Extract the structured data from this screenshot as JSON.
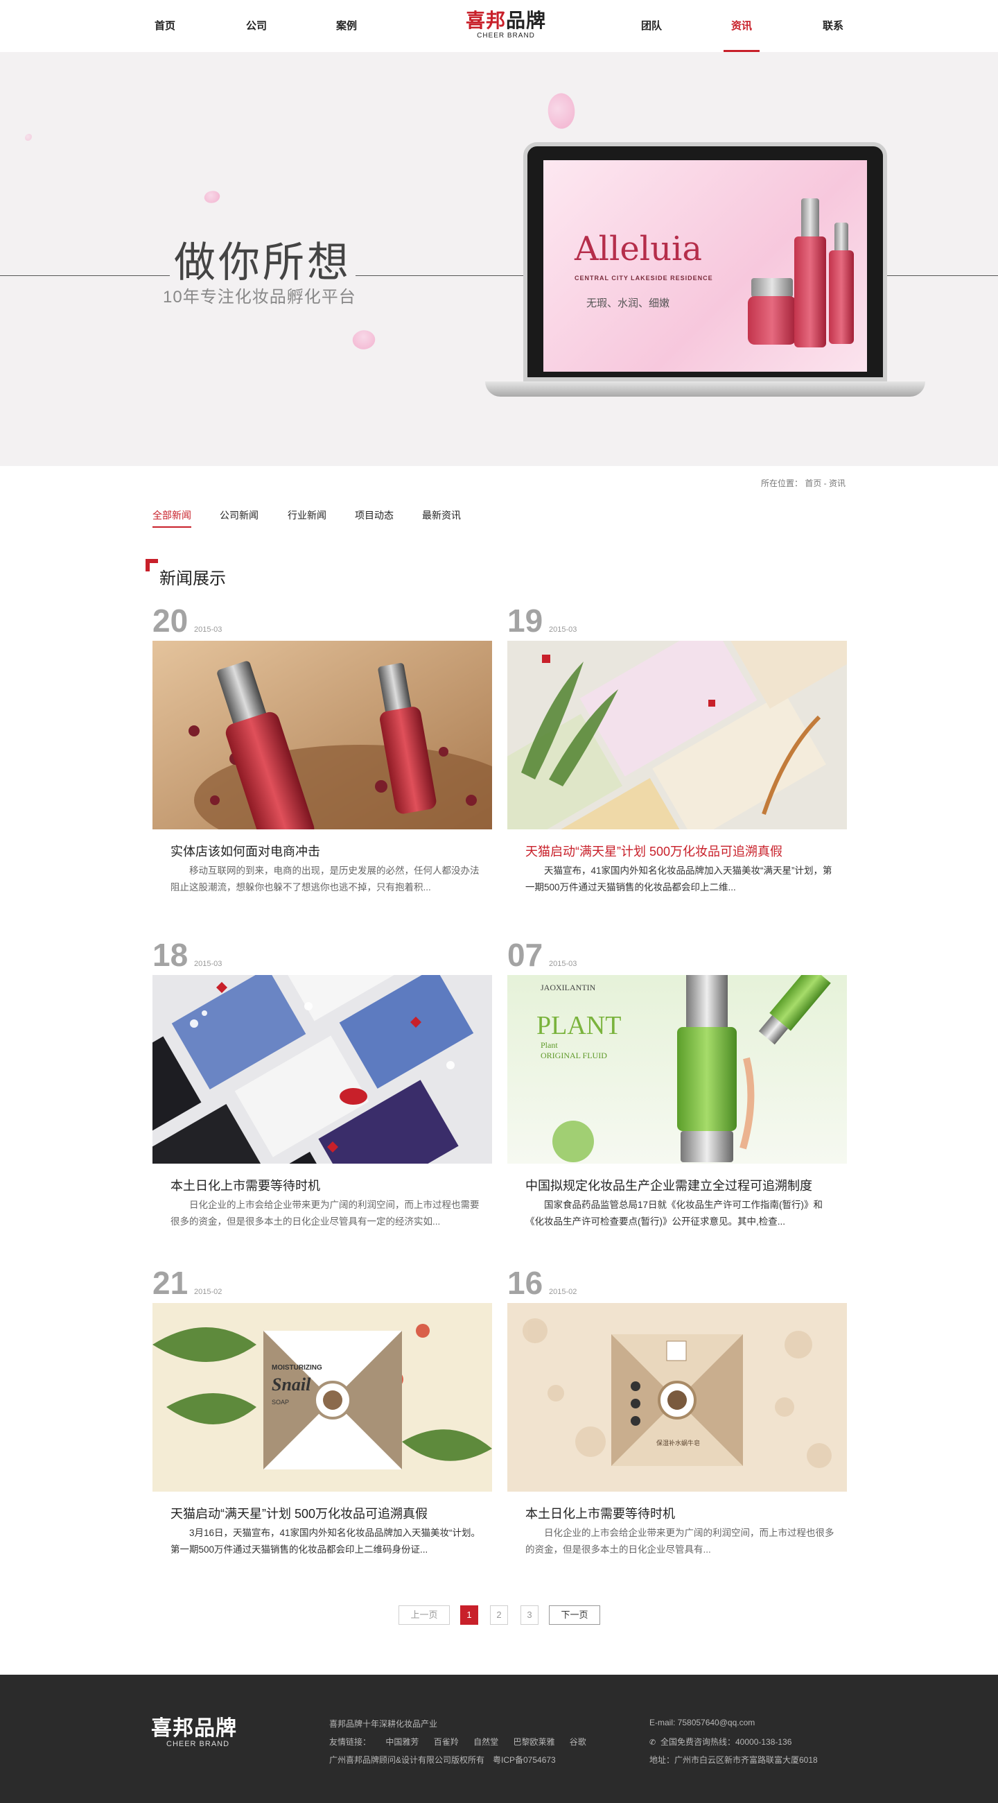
{
  "nav": {
    "left": [
      "首页",
      "公司",
      "案例"
    ],
    "right": [
      "团队",
      "资讯",
      "联系"
    ],
    "logo_cn_a": "喜邦",
    "logo_cn_b": "品牌",
    "logo_en": "CHEER BRAND"
  },
  "hero": {
    "title": "做你所想",
    "subtitle": "10年专注化妆品孵化平台",
    "screen_brand": "Alleluia",
    "screen_brand_sub": "CENTRAL CITY LAKESIDE RESIDENCE",
    "screen_tagline": "无瑕、水润、细嫩"
  },
  "breadcrumb": "所在位置： 首页 - 资讯",
  "tabs": [
    "全部新闻",
    "公司新闻",
    "行业新闻",
    "项目动态",
    "最新资讯"
  ],
  "section_title": "新闻展示",
  "news": [
    {
      "day": "20",
      "month": "2015-03",
      "title": "实体店该如何面对电商冲击",
      "desc": "移动互联网的到来，电商的出现，是历史发展的必然，任何人都没办法阻止这股潮流，想躲你也躲不了想逃你也逃不掉，只有抱着积...",
      "image": "red-essential-oil-bottles-with-rose-buds"
    },
    {
      "day": "19",
      "month": "2015-03",
      "title": "天猫启动“满天星”计划 500万化妆品可追溯真假",
      "desc": "天猫宣布，41家国内外知名化妆品品牌加入天猫美妆“满天星”计划，第一期500万件通过天猫销售的化妆品都会印上二维...",
      "image": "botanical-facial-mask-packets"
    },
    {
      "day": "18",
      "month": "2015-03",
      "title": "本土日化上市需要等待时机",
      "desc": "日化企业的上市会给企业带来更为广阔的利润空间，而上市过程也需要很多的资金，但是很多本土的日化企业尽管具有一定的经济实如...",
      "image": "blue-black-white-mask-packets"
    },
    {
      "day": "07",
      "month": "2015-03",
      "title": "中国拟规定化妆品生产企业需建立全过程可追溯制度",
      "desc": "国家食品药品监管总局17日就《化妆品生产许可工作指南(暂行)》和《化妆品生产许可检查要点(暂行)》公开征求意见。其中,检查...",
      "image": "green-plant-original-fluid-bottle",
      "screen_texts": [
        "JAOXILANTIN",
        "PLANT",
        "Plant",
        "ORIGINAL FLUID"
      ]
    },
    {
      "day": "21",
      "month": "2015-02",
      "title": "天猫启动“满天星”计划 500万化妆品可追溯真假",
      "desc": "3月16日，天猫宣布，41家国内外知名化妆品品牌加入天猫美妆“计划。第一期500万件通过天猫销售的化妆品都会印上二维码身份证...",
      "image": "snail-soap-package-with-flowers",
      "screen_texts": [
        "MOISTURIZING",
        "Snail",
        "SOAP",
        "保湿补水蜗牛皂"
      ]
    },
    {
      "day": "16",
      "month": "2015-02",
      "title": "本土日化上市需要等待时机",
      "desc": "日化企业的上市会给企业带来更为广阔的利润空间，而上市过程也很多的资金，但是很多本土的日化企业尽管具有...",
      "image": "beige-snail-soap-package",
      "screen_texts": [
        "保湿补水蜗牛皂"
      ]
    }
  ],
  "pagination": {
    "prev": "上一页",
    "pages": [
      "1",
      "2",
      "3"
    ],
    "current": "1",
    "next": "下一页"
  },
  "footer": {
    "slogan": "喜邦品牌十年深耕化妆品产业",
    "links_label": "友情链接：",
    "links": [
      "中国雅芳",
      "百雀羚",
      "自然堂",
      "巴黎欧莱雅",
      "谷歌"
    ],
    "copyright": "广州喜邦品牌顾问&设计有限公司版权所有　粤ICP备0754673",
    "email": "E-mail: 758057640@qq.com",
    "hotline": "全国免费咨询热线：40000-138-136",
    "address": "地址：广州市白云区新市齐富路联富大厦6018"
  },
  "colors": {
    "accent": "#c8202a",
    "footer_bg": "#2b2b2b",
    "hero_bg": "#f3f1f2"
  }
}
